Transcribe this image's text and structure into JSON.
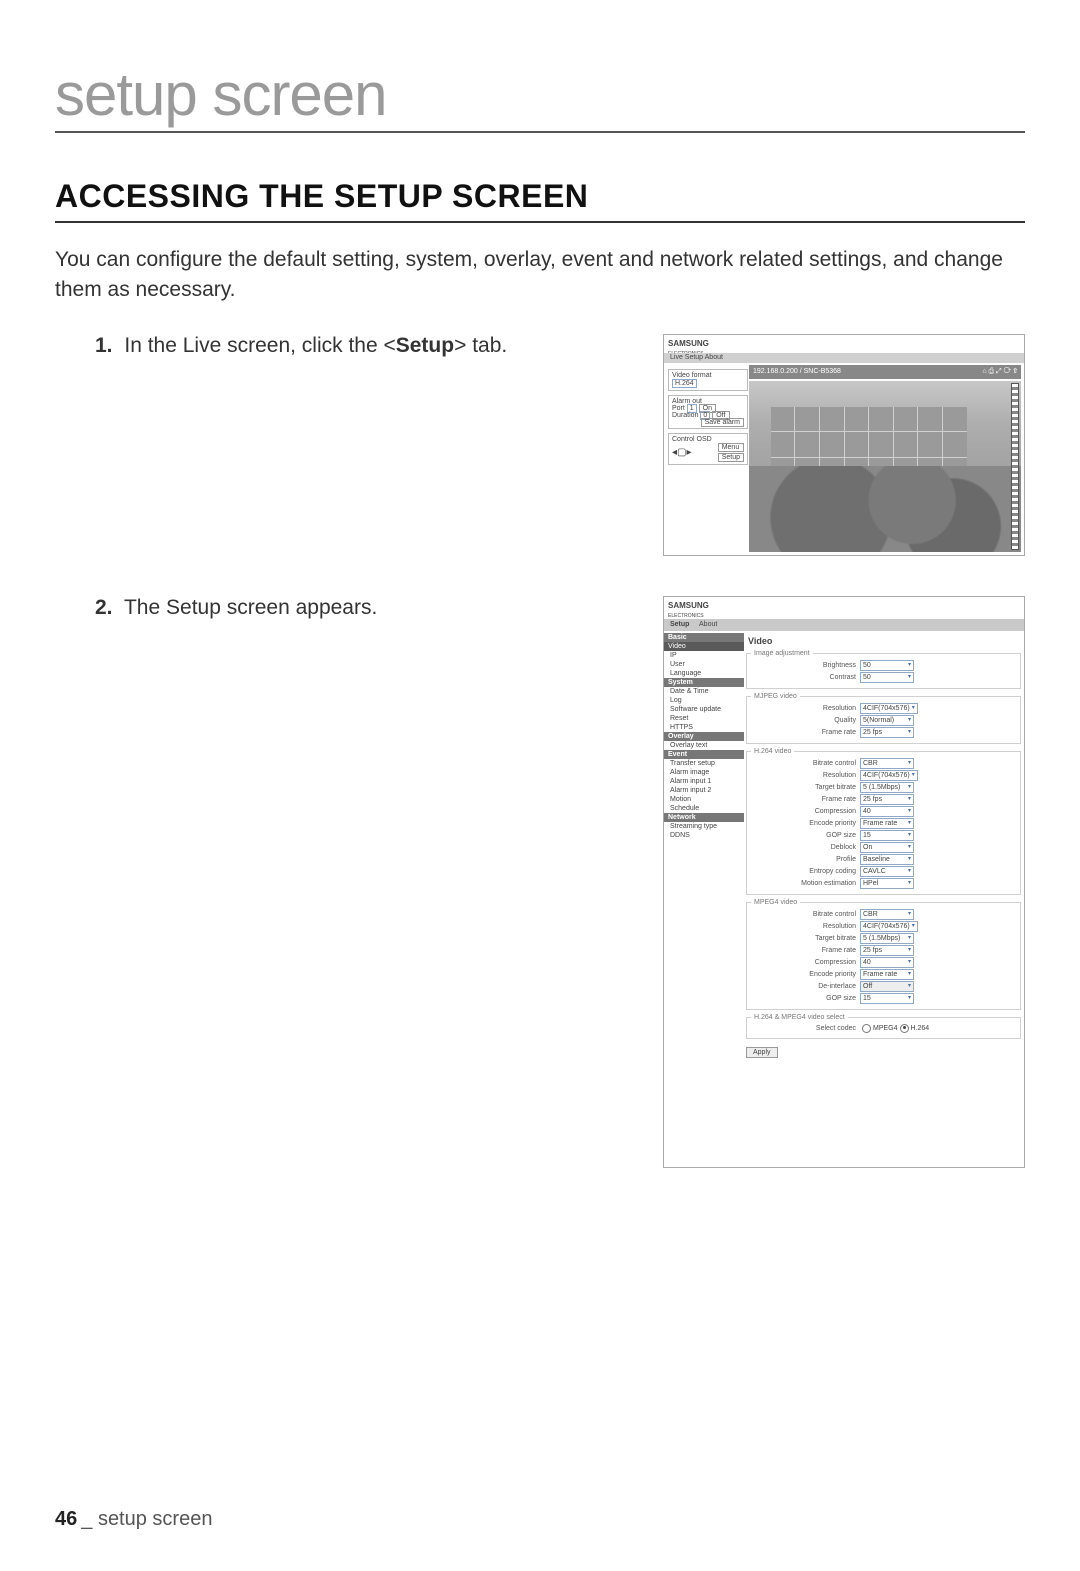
{
  "chapter_title": "setup screen",
  "section_title": "ACCESSING THE SETUP SCREEN",
  "intro": "You can configure the default setting, system, overlay, event and network related settings, and change them as necessary.",
  "step1": {
    "num": "1.",
    "pre": "In the Live screen, click the <",
    "bold": "Setup",
    "post": "> tab."
  },
  "step2": {
    "num": "2.",
    "text": "The Setup screen appears."
  },
  "footer": {
    "page": "46",
    "sep": "_",
    "label": "setup screen"
  },
  "live": {
    "logo": "SAMSUNG",
    "logo_sub": "ELECTRONICS",
    "menu": "Live  Setup  About",
    "video_format_label": "Video format",
    "video_format_value": "H.264",
    "alarm_out_label": "Alarm out",
    "port_label": "Port",
    "port_value": "1",
    "duration_label": "Duration",
    "duration_value": "0",
    "btn_on": "On",
    "btn_off": "Off",
    "btn_save": "Save alarm",
    "control_osd_label": "Control OSD",
    "btn_menu": "Menu",
    "btn_setup": "Setup",
    "ip_title": "192.168.0.200 / SNC-B5368",
    "icons": "⌂ ⎙ ⤢ ⟳ ⇧"
  },
  "setup": {
    "logo": "SAMSUNG",
    "logo_sub": "ELECTRONICS",
    "tab_setup": "Setup",
    "tab_about": "About",
    "sidebar": {
      "basic": "Basic",
      "video": "Video",
      "ip": "IP",
      "user": "User",
      "language": "Language",
      "system": "System",
      "date_time": "Date & Time",
      "log": "Log",
      "software_update": "Software update",
      "reset": "Reset",
      "https": "HTTPS",
      "overlay": "Overlay",
      "overlay_text": "Overlay text",
      "event": "Event",
      "transfer_setup": "Transfer setup",
      "alarm_image": "Alarm image",
      "alarm_input1": "Alarm input 1",
      "alarm_input2": "Alarm input 2",
      "motion": "Motion",
      "schedule": "Schedule",
      "network": "Network",
      "streaming_type": "Streaming type",
      "ddns": "DDNS"
    },
    "panel_title": "Video",
    "image_adjustment": {
      "legend": "Image adjustment",
      "brightness": {
        "label": "Brightness",
        "value": "50"
      },
      "contrast": {
        "label": "Contrast",
        "value": "50"
      }
    },
    "mjpeg": {
      "legend": "MJPEG video",
      "resolution": {
        "label": "Resolution",
        "value": "4CIF(704x576)"
      },
      "quality": {
        "label": "Quality",
        "value": "5(Normal)"
      },
      "frame_rate": {
        "label": "Frame rate",
        "value": "25 fps"
      }
    },
    "h264": {
      "legend": "H.264 video",
      "bitrate_control": {
        "label": "Bitrate control",
        "value": "CBR"
      },
      "resolution": {
        "label": "Resolution",
        "value": "4CIF(704x576)"
      },
      "target_bitrate": {
        "label": "Target bitrate",
        "value": "5 (1.5Mbps)"
      },
      "frame_rate": {
        "label": "Frame rate",
        "value": "25 fps"
      },
      "compression": {
        "label": "Compression",
        "value": "40"
      },
      "encode_priority": {
        "label": "Encode priority",
        "value": "Frame rate"
      },
      "gop_size": {
        "label": "GOP size",
        "value": "15"
      },
      "deblock": {
        "label": "Deblock",
        "value": "On"
      },
      "profile": {
        "label": "Profile",
        "value": "Baseline"
      },
      "entropy_coding": {
        "label": "Entropy coding",
        "value": "CAVLC"
      },
      "motion_est": {
        "label": "Motion estimation",
        "value": "HPel"
      }
    },
    "mpeg4": {
      "legend": "MPEG4 video",
      "bitrate_control": {
        "label": "Bitrate control",
        "value": "CBR"
      },
      "resolution": {
        "label": "Resolution",
        "value": "4CIF(704x576)"
      },
      "target_bitrate": {
        "label": "Target bitrate",
        "value": "5 (1.5Mbps)"
      },
      "frame_rate": {
        "label": "Frame rate",
        "value": "25 fps"
      },
      "compression": {
        "label": "Compression",
        "value": "40"
      },
      "encode_priority": {
        "label": "Encode priority",
        "value": "Frame rate"
      },
      "deinterlace": {
        "label": "De-interlace",
        "value": "Off"
      },
      "gop_size": {
        "label": "GOP size",
        "value": "15"
      }
    },
    "codec_select": {
      "legend": "H.264 & MPEG4 video select",
      "label": "Select codec",
      "opt_mpeg4": "MPEG4",
      "opt_h264": "H.264"
    },
    "apply": "Apply"
  }
}
